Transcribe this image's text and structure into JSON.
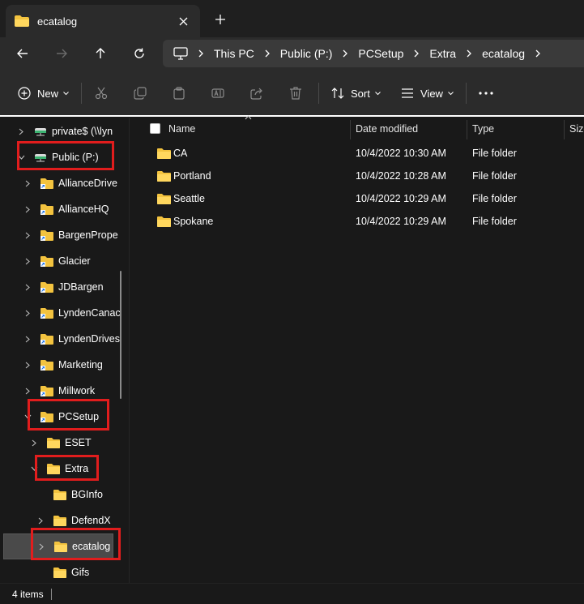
{
  "tab": {
    "title": "ecatalog"
  },
  "breadcrumb": [
    "This PC",
    "Public (P:)",
    "PCSetup",
    "Extra",
    "ecatalog"
  ],
  "commands": {
    "new": "New",
    "sort": "Sort",
    "view": "View"
  },
  "nav": {
    "items": [
      {
        "label": "private$ (\\\\lyn",
        "type": "drive"
      },
      {
        "label": "Public (P:)",
        "type": "drive"
      },
      {
        "label": "AllianceDrive",
        "type": "shortcut-folder"
      },
      {
        "label": "AllianceHQ",
        "type": "shortcut-folder"
      },
      {
        "label": "BargenPrope",
        "type": "shortcut-folder"
      },
      {
        "label": "Glacier",
        "type": "shortcut-folder"
      },
      {
        "label": "JDBargen",
        "type": "shortcut-folder"
      },
      {
        "label": "LyndenCanac",
        "type": "shortcut-folder"
      },
      {
        "label": "LyndenDrives",
        "type": "shortcut-folder"
      },
      {
        "label": "Marketing",
        "type": "shortcut-folder"
      },
      {
        "label": "Millwork",
        "type": "shortcut-folder"
      },
      {
        "label": "PCSetup",
        "type": "folder"
      },
      {
        "label": "ESET",
        "type": "folder"
      },
      {
        "label": "Extra",
        "type": "folder"
      },
      {
        "label": "BGInfo",
        "type": "folder"
      },
      {
        "label": "DefendX",
        "type": "folder"
      },
      {
        "label": "ecatalog",
        "type": "folder",
        "selected": true
      },
      {
        "label": "Gifs",
        "type": "folder"
      }
    ]
  },
  "columns": {
    "name": "Name",
    "date": "Date modified",
    "type": "Type",
    "size": "Size"
  },
  "files": [
    {
      "name": "CA",
      "date": "10/4/2022 10:30 AM",
      "type": "File folder"
    },
    {
      "name": "Portland",
      "date": "10/4/2022 10:28 AM",
      "type": "File folder"
    },
    {
      "name": "Seattle",
      "date": "10/4/2022 10:29 AM",
      "type": "File folder"
    },
    {
      "name": "Spokane",
      "date": "10/4/2022 10:29 AM",
      "type": "File folder"
    }
  ],
  "status": {
    "count": "4 items"
  },
  "colors": {
    "highlight": "#e11d1d",
    "folder": "#f3c33f",
    "background": "#191919"
  }
}
